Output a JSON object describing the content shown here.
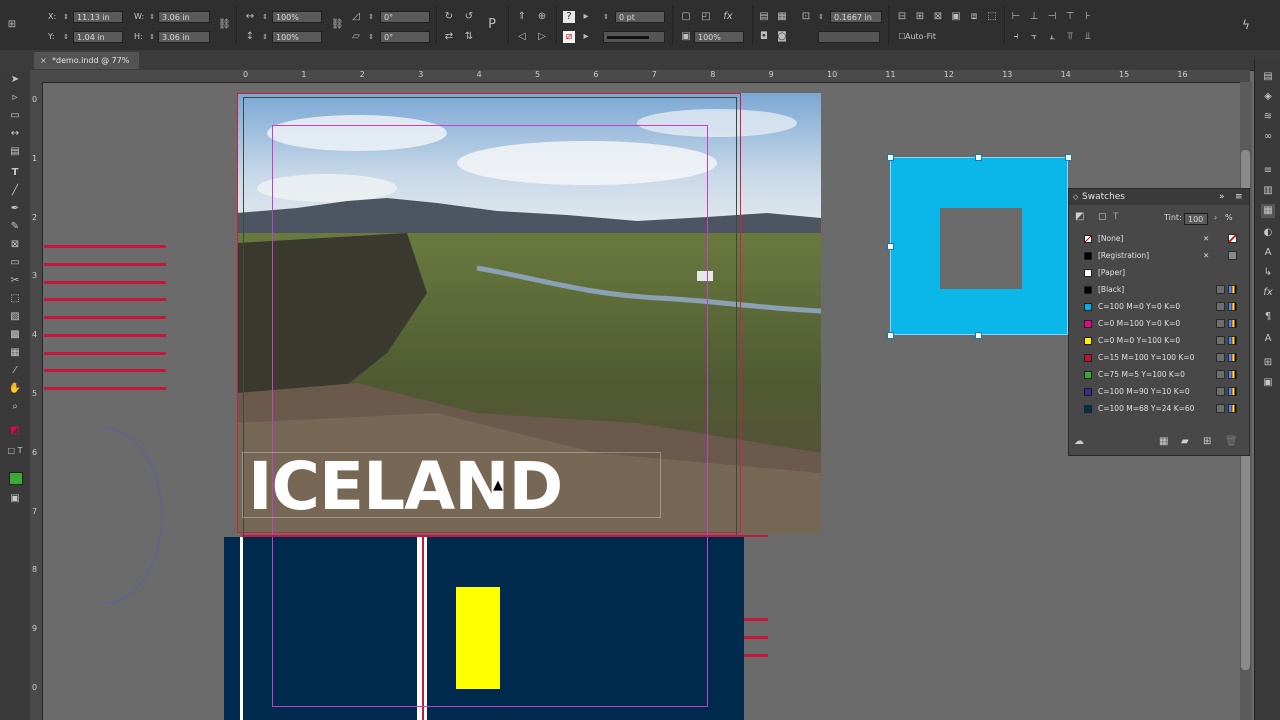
{
  "control_bar": {
    "x_label": "X:",
    "x_value": "11.13 in",
    "y_label": "Y:",
    "y_value": "1.04 in",
    "w_label": "W:",
    "w_value": "3.06 in",
    "h_label": "H:",
    "h_value": "3.06 in",
    "scale_x": "100%",
    "scale_y": "100%",
    "rotate": "0°",
    "shear": "0°",
    "stroke_weight": "0 pt",
    "opacity": "100%",
    "offset": "0.1667 in",
    "autofit_label": "Auto-Fit"
  },
  "document_tab": {
    "label": "*demo.indd @ 77%"
  },
  "ruler": {
    "horizontal": [
      "0",
      "1",
      "2",
      "3",
      "4",
      "5",
      "6",
      "7",
      "8",
      "9",
      "10",
      "11",
      "12",
      "13",
      "14",
      "15",
      "16"
    ],
    "vertical": [
      "0",
      "1",
      "2",
      "3",
      "4",
      "5",
      "6",
      "7",
      "8",
      "9",
      "0"
    ]
  },
  "canvas": {
    "headline": "ICELAND",
    "colors": {
      "accent_red": "#c8173d",
      "navy": "#002a4d",
      "cyan": "#0ab7e8",
      "yellow": "#ffff00",
      "pasteboard": "#6b6b6b"
    }
  },
  "swatches": {
    "title": "Swatches",
    "tint_label": "Tint:",
    "tint_value": "100",
    "tint_unit": "%",
    "items": [
      {
        "name": "[None]",
        "color": "#ffffff"
      },
      {
        "name": "[Registration]",
        "color": "#000000"
      },
      {
        "name": "[Paper]",
        "color": "#ffffff"
      },
      {
        "name": "[Black]",
        "color": "#000000"
      },
      {
        "name": "C=100 M=0 Y=0 K=0",
        "color": "#00aeef"
      },
      {
        "name": "C=0 M=100 Y=0 K=0",
        "color": "#ec008c"
      },
      {
        "name": "C=0 M=0 Y=100 K=0",
        "color": "#fff200"
      },
      {
        "name": "C=15 M=100 Y=100 K=0",
        "color": "#c8102e"
      },
      {
        "name": "C=75 M=5 Y=100 K=0",
        "color": "#3aaa35"
      },
      {
        "name": "C=100 M=90 Y=10 K=0",
        "color": "#2e3192"
      },
      {
        "name": "C=100 M=68 Y=24 K=60",
        "color": "#003050"
      }
    ]
  }
}
